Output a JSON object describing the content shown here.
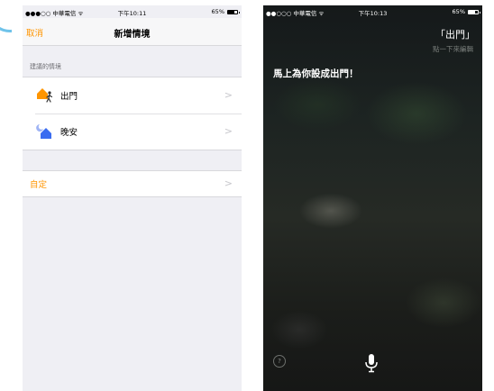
{
  "left": {
    "status": {
      "carrier": "●●●○○ 中華電信 ᯤ",
      "time": "下午10:11",
      "battery": "65%"
    },
    "nav": {
      "cancel_label": "取消",
      "title": "新增情境"
    },
    "section_label": "建議的情境",
    "scenes": [
      {
        "label": "出門",
        "icon": "leave-home-icon"
      },
      {
        "label": "晚安",
        "icon": "good-night-icon"
      }
    ],
    "custom_label": "自定",
    "chevron": ">",
    "colors": {
      "accent": "#ff9500",
      "background": "#efeff4",
      "house": "#ff9500",
      "night-house": "#3a6cf0"
    }
  },
  "right": {
    "status": {
      "carrier": "●●○○○ 中華電信 ᯤ",
      "time": "下午10:13",
      "battery": "65%"
    },
    "query": "「出門」",
    "edit_hint": "點一下來編輯",
    "reply": "馬上為你設成出門！",
    "help_label": "?",
    "mic_icon": "microphone-icon"
  }
}
